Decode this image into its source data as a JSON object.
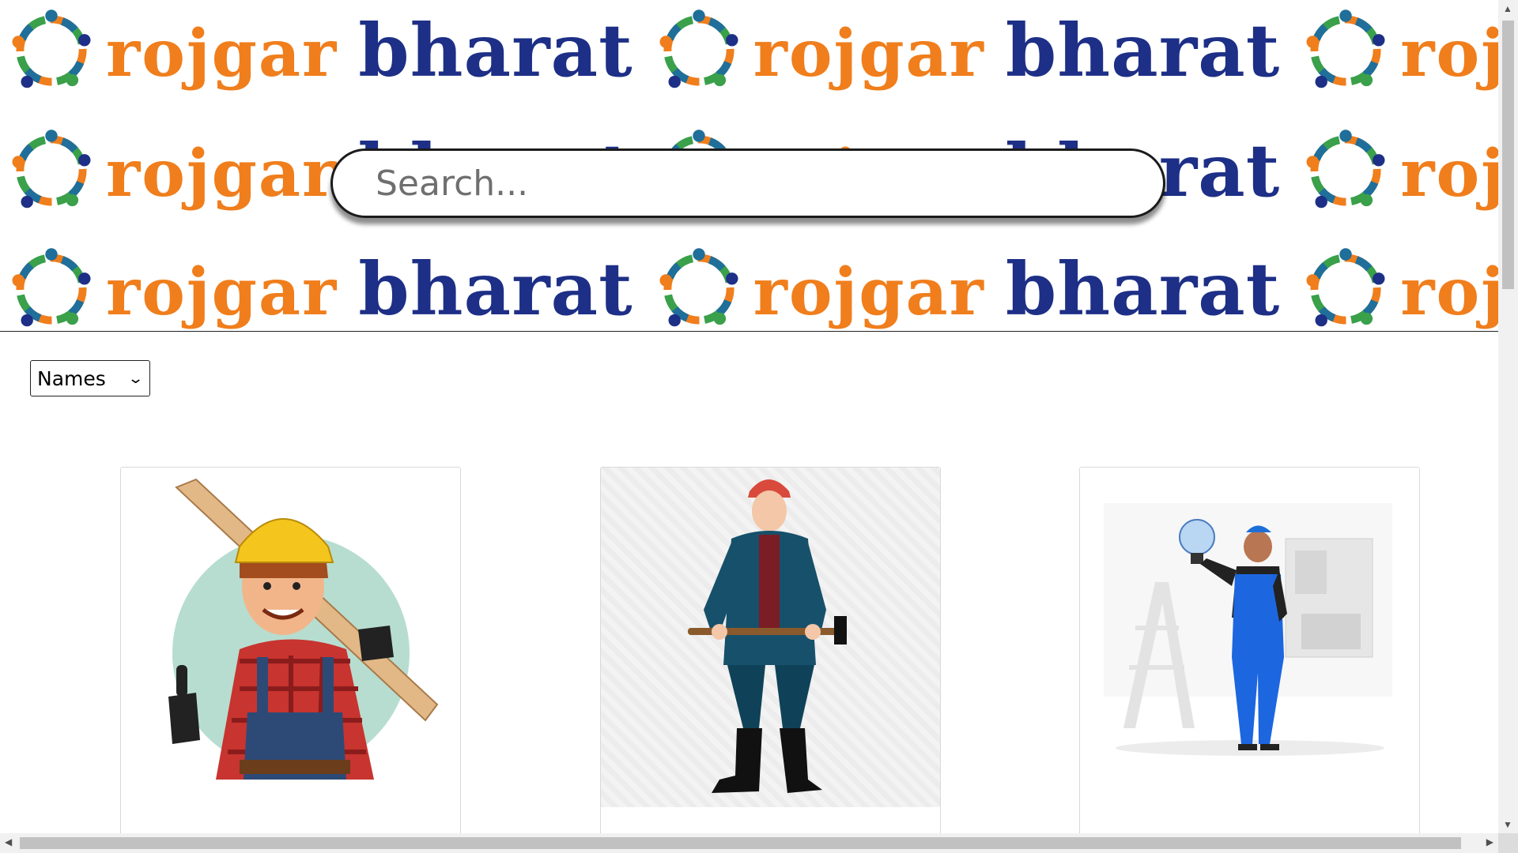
{
  "banner": {
    "word1": "rojgar",
    "word2": "bharat",
    "colors": {
      "orange": "#f07e1c",
      "navy": "#1d2f86",
      "green": "#3aa04a",
      "teal": "#1f6f9a"
    },
    "logo_icon": "people-circle-logo"
  },
  "search": {
    "placeholder": "Search..."
  },
  "filter": {
    "selected": "Names",
    "icon": "chevron-down-icon"
  },
  "cards": [
    {
      "image": "carpenter-with-plank-illustration"
    },
    {
      "image": "worker-with-sledgehammer-illustration"
    },
    {
      "image": "electrician-with-lightbulb-illustration"
    }
  ],
  "scrollbars": {
    "vertical": true,
    "horizontal": true
  }
}
